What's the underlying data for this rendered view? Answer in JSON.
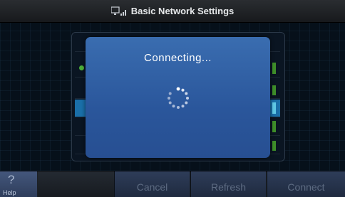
{
  "titlebar": {
    "title": "Basic Network Settings",
    "icon": "network-icon"
  },
  "dialog": {
    "title": "Connecting...",
    "icon": "loading-spinner-icon"
  },
  "bottombar": {
    "help_symbol": "?",
    "help_label": "Help",
    "buttons": [
      {
        "label": "Cancel"
      },
      {
        "label": "Refresh"
      },
      {
        "label": "Connect"
      }
    ]
  },
  "colors": {
    "dialog_bg": "#2f5fa3",
    "accent_green": "#4caf3a",
    "highlight_row": "#1a6fa8"
  }
}
